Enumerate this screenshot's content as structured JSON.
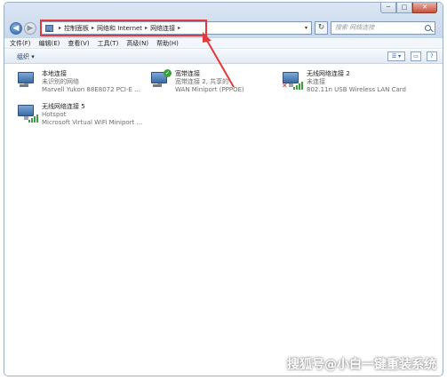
{
  "window": {
    "caption": {
      "minimize": "─",
      "maximize": "□",
      "close": "✕"
    }
  },
  "nav": {
    "back": "◀",
    "forward": "▶"
  },
  "address": {
    "crumbs": [
      "控制面板",
      "网络和 Internet",
      "网络连接"
    ],
    "separator": "▸",
    "dropdown": "▾"
  },
  "refresh": "↻",
  "search": {
    "placeholder": "搜索 网络连接"
  },
  "menubar": {
    "items": [
      "文件(F)",
      "编辑(E)",
      "查看(V)",
      "工具(T)",
      "高级(N)",
      "帮助(H)"
    ]
  },
  "toolbar": {
    "organize": "组织 ▾",
    "view_icon": "☰ ▾",
    "pane_icon": "▭",
    "help_icon": "?"
  },
  "connections": [
    {
      "name": "本地连接",
      "status": "未识别的网络",
      "device": "Marvell Yukon 88E8072 PCI-E ...",
      "icon": "ethernet-icon"
    },
    {
      "name": "宽带连接",
      "status": "宽带连接 2, 共享的",
      "device": "WAN Miniport (PPPOE)",
      "icon": "broadband-icon"
    },
    {
      "name": "无线网络连接 2",
      "status": "未连接",
      "device": "802.11n USB Wireless LAN Card",
      "icon": "wireless-icon"
    },
    {
      "name": "无线网络连接 5",
      "status": "Hotspot",
      "device": "Microsoft Virtual WiFi Miniport ...",
      "icon": "wireless-icon"
    }
  ],
  "watermark": "搜狐号@小白一键重装系统",
  "colors": {
    "highlight": "#e03a3a",
    "accent": "#2a5fa7"
  }
}
